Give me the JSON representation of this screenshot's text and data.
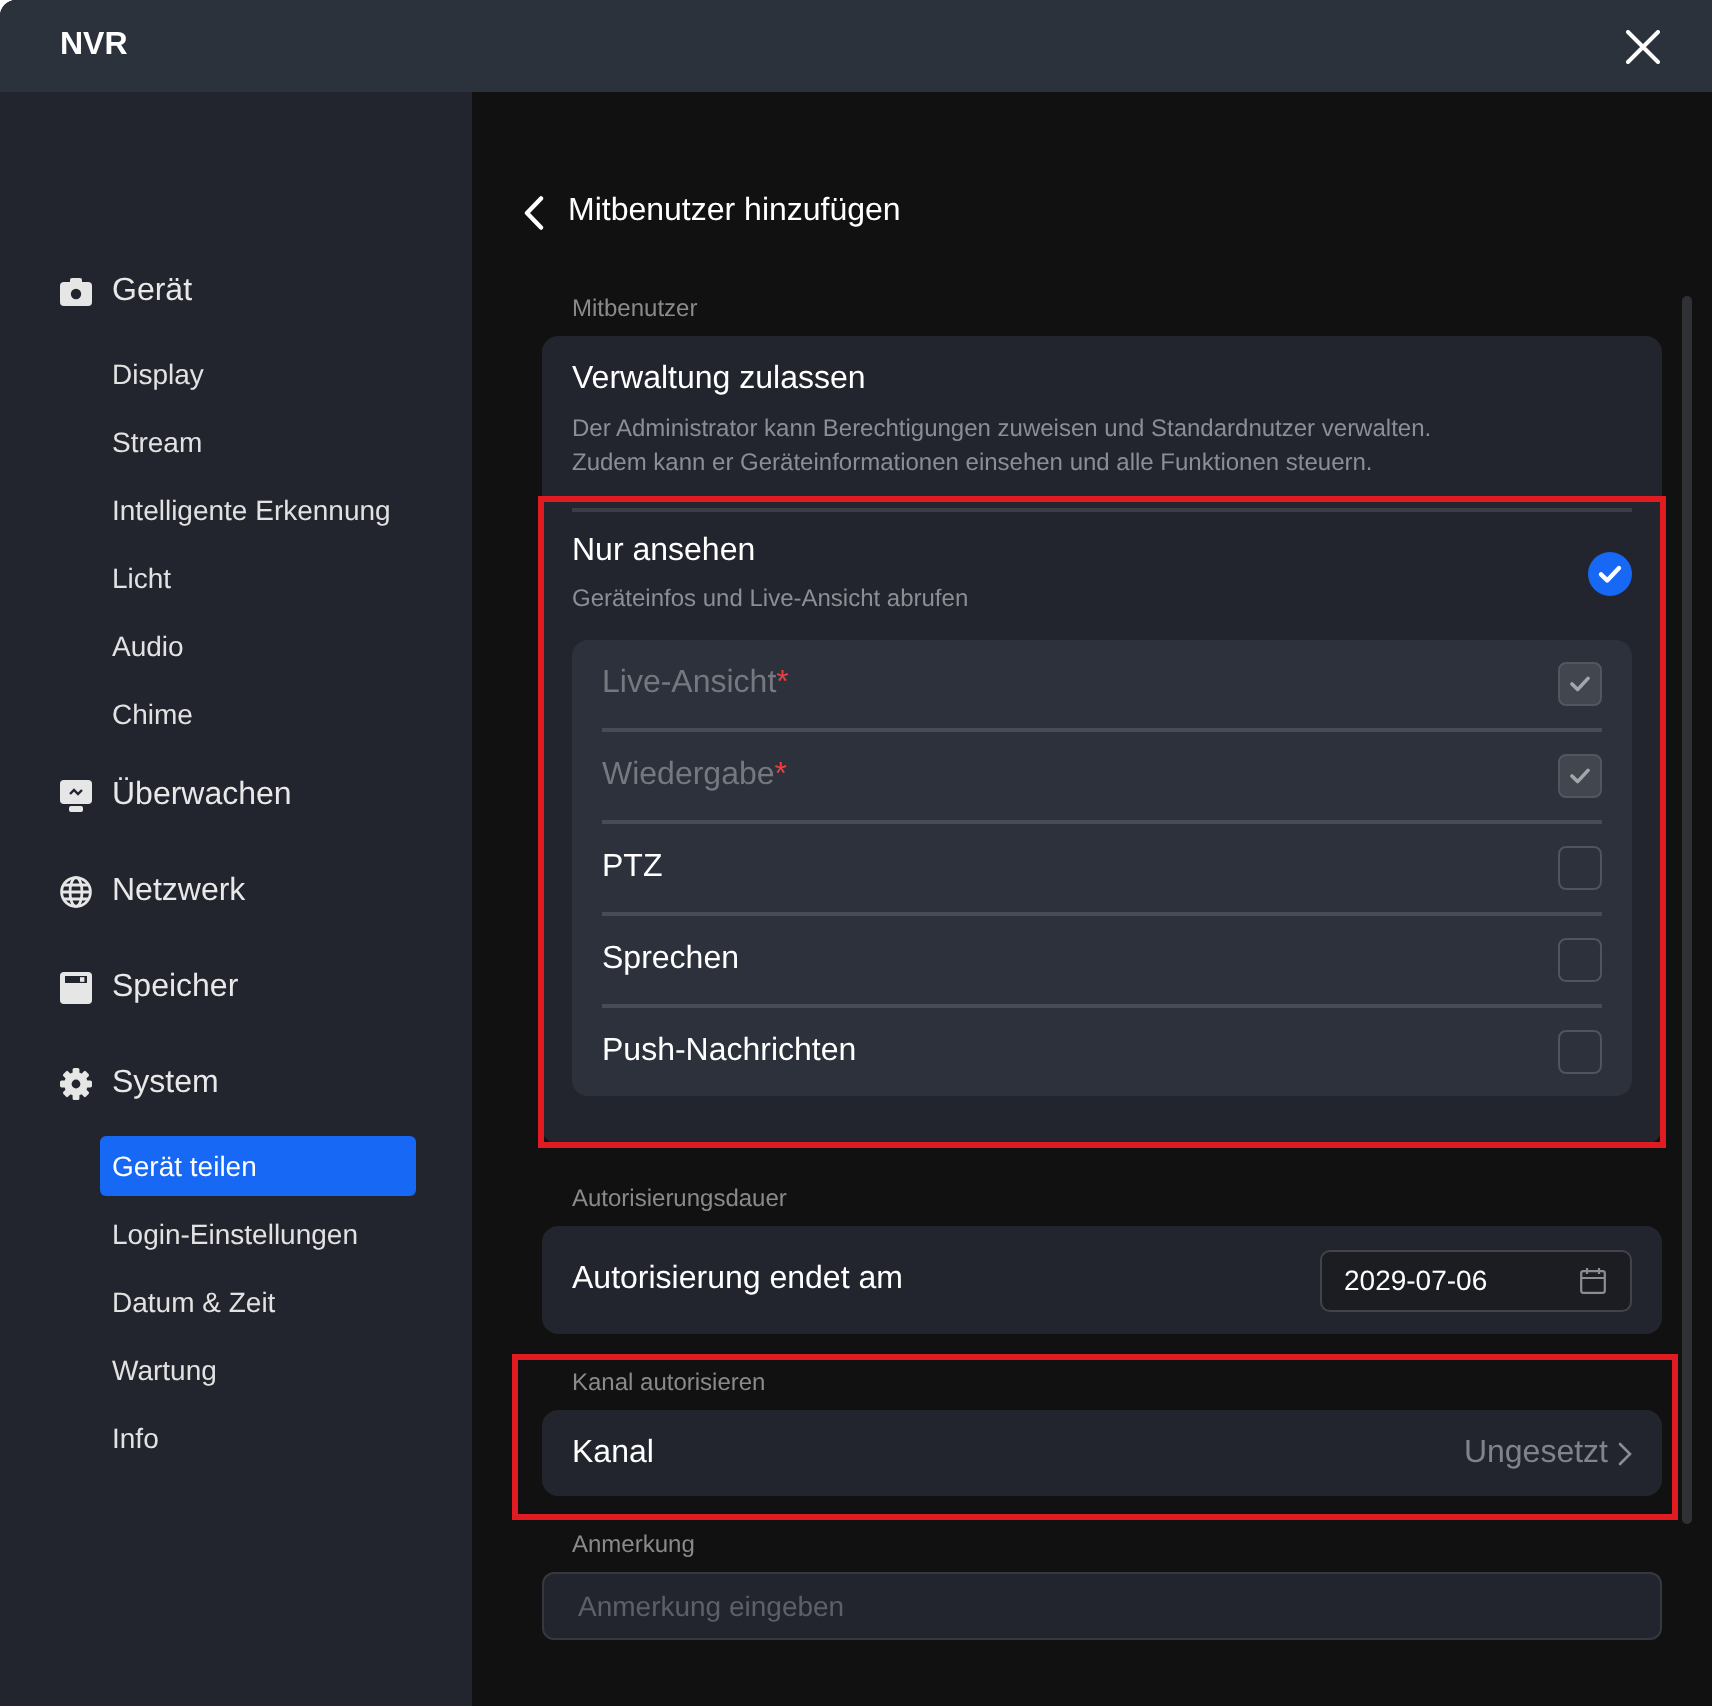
{
  "window": {
    "title": "NVR"
  },
  "sidebar": {
    "items": [
      {
        "label": "Gerät",
        "selected": false,
        "children": [
          {
            "label": "Display",
            "selected": false
          },
          {
            "label": "Stream",
            "selected": false
          },
          {
            "label": "Intelligente Erkennung",
            "selected": false
          },
          {
            "label": "Licht",
            "selected": false
          },
          {
            "label": "Audio",
            "selected": false
          },
          {
            "label": "Chime",
            "selected": false
          }
        ]
      },
      {
        "label": "Überwachen",
        "selected": false
      },
      {
        "label": "Netzwerk",
        "selected": false
      },
      {
        "label": "Speicher",
        "selected": false
      },
      {
        "label": "System",
        "selected": false,
        "children": [
          {
            "label": "Gerät teilen",
            "selected": true
          },
          {
            "label": "Login-Einstellungen",
            "selected": false
          },
          {
            "label": "Datum & Zeit",
            "selected": false
          },
          {
            "label": "Wartung",
            "selected": false
          },
          {
            "label": "Info",
            "selected": false
          }
        ]
      }
    ]
  },
  "page": {
    "title": "Mitbenutzer hinzufügen"
  },
  "sections": [
    {
      "kind": "options",
      "label": "Mitbenutzer",
      "highlighted": false,
      "options": [
        {
          "title": "Verwaltung zulassen",
          "description": "Der Administrator kann Berechtigungen zuweisen und Standardnutzer verwalten.\nZudem kann er Geräteinformationen einsehen und alle Funktionen steuern.",
          "selected": false,
          "highlighted": false
        },
        {
          "title": "Nur ansehen",
          "description": "Geräteinfos und Live-Ansicht abrufen",
          "selected": true,
          "highlighted": true,
          "permissions": [
            {
              "label": "Live-Ansicht",
              "required_mark": "*",
              "checked": true,
              "disabled": true
            },
            {
              "label": "Wiedergabe",
              "required_mark": "*",
              "checked": true,
              "disabled": true
            },
            {
              "label": "PTZ",
              "checked": false,
              "disabled": false
            },
            {
              "label": "Sprechen",
              "checked": false,
              "disabled": false
            },
            {
              "label": "Push-Nachrichten",
              "checked": false,
              "disabled": false
            }
          ]
        }
      ]
    },
    {
      "kind": "date",
      "label": "Autorisierungsdauer",
      "highlighted": false,
      "title": "Autorisierung endet am",
      "value": "2029-07-06"
    },
    {
      "kind": "link",
      "label": "Kanal autorisieren",
      "highlighted": true,
      "title": "Kanal",
      "value": "Ungesetzt"
    },
    {
      "kind": "input",
      "label": "Anmerkung",
      "highlighted": false,
      "placeholder": "Anmerkung eingeben"
    }
  ]
}
